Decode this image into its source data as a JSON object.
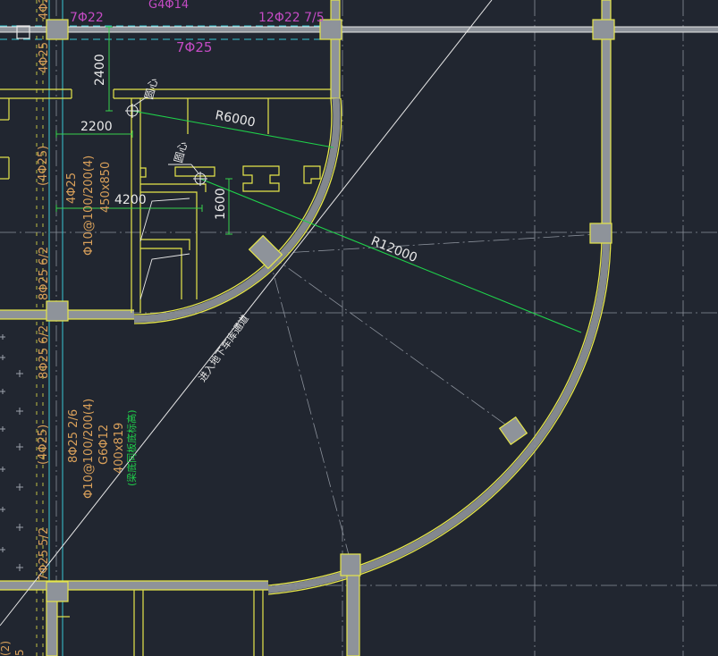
{
  "colors": {
    "background": "#212630",
    "wall": "#e6e64a",
    "wall_fill": "#8e939a",
    "axis": "#9aa0aa",
    "cyan": "#39c7d4",
    "magenta": "#c44bc4",
    "rebar_text": "#d9a05a",
    "white": "#e8e8e8",
    "green": "#1fd04a",
    "dim_green": "#37d24d"
  },
  "labels": {
    "top_left_rebar": "4Φ25",
    "top_7_22": "7Φ22",
    "top_g4": "G4Φ14",
    "top_12_22": "12Φ22 7/5",
    "top_7_25": "7Φ25",
    "left_4_25_top": "4Φ25",
    "dim_2400": "2400",
    "dim_2200": "2200",
    "dim_4200": "4200",
    "dim_1600": "1600",
    "center_1": "圆心",
    "center_2": "圆心",
    "r6000": "R6000",
    "r12000": "R12000",
    "beam_left_paren": "(4Φ25)",
    "beam_4_25": "4Φ25",
    "beam_stirrup": "Φ10@100/200(4)",
    "beam_size": "450x850",
    "col_8_25_62a": "8Φ25 6/2",
    "col_8_25_62b": "8Φ25 6/2",
    "lower_paren": "(4Φ25)",
    "lower_8_25": "8Φ25 2/6",
    "lower_stirrup": "Φ10@100/200(4)",
    "lower_g6": "G6Φ12",
    "lower_size": "400x819",
    "lower_note": "(梁底同板底标高)",
    "col_7_25": "7Φ25 5/2",
    "diag_text": "进入地下车库通道",
    "bottom_left_2": "(2)",
    "bottom_left_5": "5"
  }
}
